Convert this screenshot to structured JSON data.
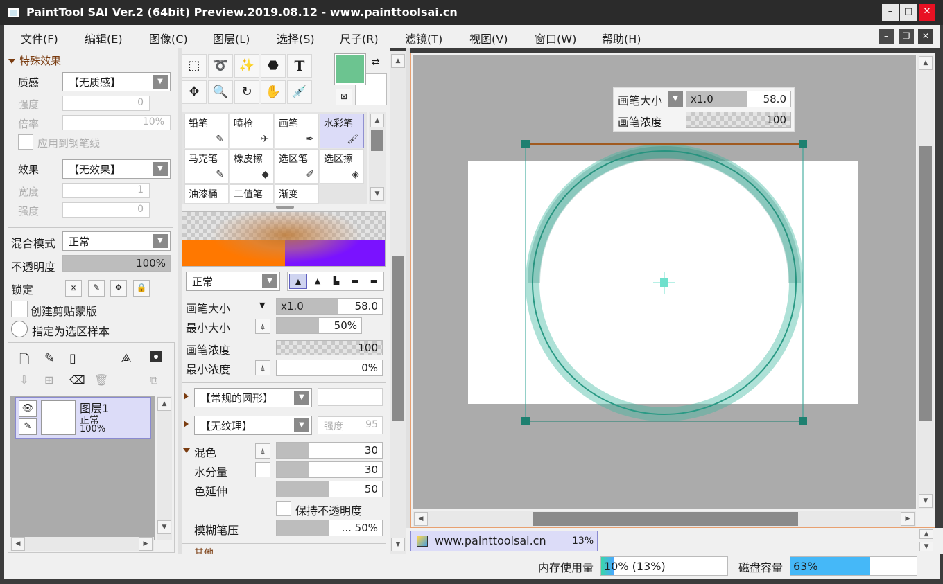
{
  "window": {
    "title": "PaintTool SAI Ver.2 (64bit) Preview.2019.08.12 - www.painttoolsai.cn",
    "minimize": "–",
    "maximize": "□",
    "close": "✕"
  },
  "menu": [
    {
      "label": "文件(F)"
    },
    {
      "label": "编辑(E)"
    },
    {
      "label": "图像(C)"
    },
    {
      "label": "图层(L)"
    },
    {
      "label": "选择(S)"
    },
    {
      "label": "尺子(R)"
    },
    {
      "label": "滤镜(T)"
    },
    {
      "label": "视图(V)"
    },
    {
      "label": "窗口(W)"
    },
    {
      "label": "帮助(H)"
    }
  ],
  "layer_props": {
    "fx_header": "特殊效果",
    "texture_label": "质感",
    "texture_value": "【无质感】",
    "tex_strength_label": "强度",
    "tex_strength_value": "0",
    "tex_scale_label": "倍率",
    "tex_scale_value": "10%",
    "apply_pen_label": "应用到钢笔线",
    "effect_label": "效果",
    "effect_value": "【无效果】",
    "effect_width_label": "宽度",
    "effect_width_value": "1",
    "effect_strength_label": "强度",
    "effect_strength_value": "0",
    "blend_label": "混合模式",
    "blend_value": "正常",
    "opacity_label": "不透明度",
    "opacity_value": "100%",
    "opacity_level": 1.0,
    "lock_label": "锁定",
    "clip_label": "创建剪贴蒙版",
    "sample_label": "指定为选区样本"
  },
  "layers": [
    {
      "name": "图层1",
      "mode": "正常",
      "opacity": "100%"
    }
  ],
  "tools": {
    "text_tool": "T"
  },
  "colors": {
    "primary": "#6cc490",
    "secondary": "#ffffff",
    "accent": "#3fb8a0",
    "bar_orange": "#ff7800",
    "bar_violet": "#7a12ff"
  },
  "brushes": [
    {
      "label": "铅笔",
      "icon": "pencil-icon"
    },
    {
      "label": "喷枪",
      "icon": "airbrush-icon"
    },
    {
      "label": "画笔",
      "icon": "brush-icon"
    },
    {
      "label": "水彩笔",
      "icon": "watercolor-icon",
      "selected": true
    },
    {
      "label": "马克笔",
      "icon": "marker-icon"
    },
    {
      "label": "橡皮擦",
      "icon": "eraser-icon"
    },
    {
      "label": "选区笔",
      "icon": "select-pen-icon"
    },
    {
      "label": "选区擦",
      "icon": "select-eraser-icon"
    },
    {
      "label": "油漆桶",
      "icon": ""
    },
    {
      "label": "二值笔",
      "icon": ""
    },
    {
      "label": "渐变",
      "icon": ""
    }
  ],
  "brush_settings": {
    "mode_value": "正常",
    "size_label": "画笔大小",
    "size_mult": "x1.0",
    "size_value": "58.0",
    "size_level": 0.58,
    "min_size_label": "最小大小",
    "min_size_value": "50%",
    "min_size_level": 0.5,
    "density_label": "画笔浓度",
    "density_value": "100",
    "min_density_label": "最小浓度",
    "min_density_value": "0%",
    "min_density_level": 0,
    "shape_value": "【常规的圆形】",
    "texture_value": "【无纹理】",
    "texture_strength_label": "强度",
    "texture_strength_value": "95",
    "blend_header": "混色",
    "blend_value": "30",
    "blend_level": 0.3,
    "water_label": "水分量",
    "water_value": "30",
    "water_level": 0.3,
    "extend_label": "色延伸",
    "extend_value": "50",
    "extend_level": 0.5,
    "keep_opacity_label": "保持不透明度",
    "blur_label": "模糊笔压",
    "blur_value": "... 50%",
    "blur_level": 0.5,
    "other_header": "其他"
  },
  "canvas_hud": {
    "size_label": "画笔大小",
    "size_mult": "x1.0",
    "size_value": "58.0",
    "density_label": "画笔浓度",
    "density_value": "100"
  },
  "doc_tab": {
    "name": "www.painttoolsai.cn",
    "zoom": "13%"
  },
  "status": {
    "memory_label": "内存使用量",
    "memory_value": "10% (13%)",
    "memory_level": 0.1,
    "disk_label": "磁盘容量",
    "disk_value": "63%",
    "disk_level": 0.63
  }
}
